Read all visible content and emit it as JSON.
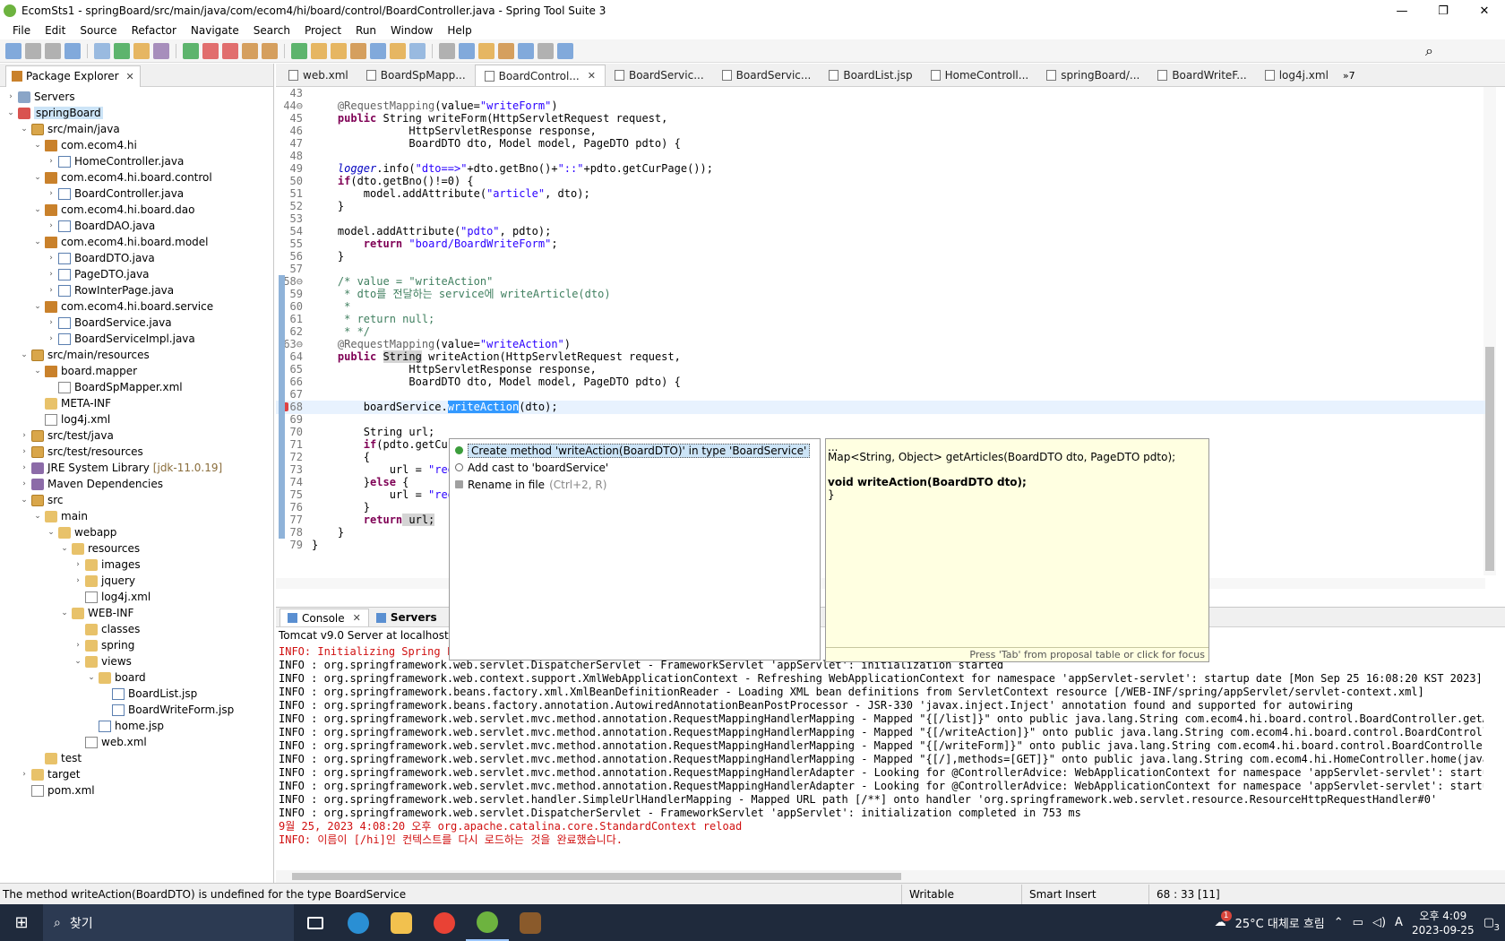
{
  "window": {
    "title": "EcomSts1 - springBoard/src/main/java/com/ecom4/hi/board/control/BoardController.java - Spring Tool Suite 3",
    "minimize": "—",
    "restore": "❐",
    "close": "✕"
  },
  "menu": [
    "File",
    "Edit",
    "Source",
    "Refactor",
    "Navigate",
    "Search",
    "Project",
    "Run",
    "Window",
    "Help"
  ],
  "package_explorer": {
    "tab_label": "Package Explorer",
    "rows": [
      {
        "indent": 0,
        "arrow": "›",
        "icon": "server",
        "label": "Servers"
      },
      {
        "indent": 0,
        "arrow": "⌄",
        "icon": "project",
        "label": "springBoard",
        "selected": true
      },
      {
        "indent": 1,
        "arrow": "⌄",
        "icon": "srcfolder",
        "label": "src/main/java"
      },
      {
        "indent": 2,
        "arrow": "⌄",
        "icon": "pkg",
        "label": "com.ecom4.hi"
      },
      {
        "indent": 3,
        "arrow": "›",
        "icon": "java",
        "label": "HomeController.java"
      },
      {
        "indent": 2,
        "arrow": "⌄",
        "icon": "pkg",
        "label": "com.ecom4.hi.board.control"
      },
      {
        "indent": 3,
        "arrow": "›",
        "icon": "java",
        "label": "BoardController.java"
      },
      {
        "indent": 2,
        "arrow": "⌄",
        "icon": "pkg",
        "label": "com.ecom4.hi.board.dao"
      },
      {
        "indent": 3,
        "arrow": "›",
        "icon": "java",
        "label": "BoardDAO.java"
      },
      {
        "indent": 2,
        "arrow": "⌄",
        "icon": "pkg",
        "label": "com.ecom4.hi.board.model"
      },
      {
        "indent": 3,
        "arrow": "›",
        "icon": "java",
        "label": "BoardDTO.java"
      },
      {
        "indent": 3,
        "arrow": "›",
        "icon": "java",
        "label": "PageDTO.java"
      },
      {
        "indent": 3,
        "arrow": "›",
        "icon": "java",
        "label": "RowInterPage.java"
      },
      {
        "indent": 2,
        "arrow": "⌄",
        "icon": "pkg",
        "label": "com.ecom4.hi.board.service"
      },
      {
        "indent": 3,
        "arrow": "›",
        "icon": "java",
        "label": "BoardService.java"
      },
      {
        "indent": 3,
        "arrow": "›",
        "icon": "java",
        "label": "BoardServiceImpl.java"
      },
      {
        "indent": 1,
        "arrow": "⌄",
        "icon": "srcfolder",
        "label": "src/main/resources"
      },
      {
        "indent": 2,
        "arrow": "⌄",
        "icon": "pkg",
        "label": "board.mapper"
      },
      {
        "indent": 3,
        "arrow": "",
        "icon": "xml",
        "label": "BoardSpMapper.xml"
      },
      {
        "indent": 2,
        "arrow": "",
        "icon": "folder",
        "label": "META-INF"
      },
      {
        "indent": 2,
        "arrow": "",
        "icon": "xml",
        "label": "log4j.xml"
      },
      {
        "indent": 1,
        "arrow": "›",
        "icon": "srcfolder",
        "label": "src/test/java"
      },
      {
        "indent": 1,
        "arrow": "›",
        "icon": "srcfolder",
        "label": "src/test/resources"
      },
      {
        "indent": 1,
        "arrow": "›",
        "icon": "lib",
        "label": "JRE System Library",
        "suffix": "[jdk-11.0.19]"
      },
      {
        "indent": 1,
        "arrow": "›",
        "icon": "lib",
        "label": "Maven Dependencies"
      },
      {
        "indent": 1,
        "arrow": "⌄",
        "icon": "srcfolder",
        "label": "src"
      },
      {
        "indent": 2,
        "arrow": "⌄",
        "icon": "folder",
        "label": "main"
      },
      {
        "indent": 3,
        "arrow": "⌄",
        "icon": "folder",
        "label": "webapp"
      },
      {
        "indent": 4,
        "arrow": "⌄",
        "icon": "folder",
        "label": "resources"
      },
      {
        "indent": 5,
        "arrow": "›",
        "icon": "folder",
        "label": "images"
      },
      {
        "indent": 5,
        "arrow": "›",
        "icon": "folder",
        "label": "jquery"
      },
      {
        "indent": 5,
        "arrow": "",
        "icon": "xml",
        "label": "log4j.xml"
      },
      {
        "indent": 4,
        "arrow": "⌄",
        "icon": "folder",
        "label": "WEB-INF"
      },
      {
        "indent": 5,
        "arrow": "",
        "icon": "folder",
        "label": "classes"
      },
      {
        "indent": 5,
        "arrow": "›",
        "icon": "folder",
        "label": "spring"
      },
      {
        "indent": 5,
        "arrow": "⌄",
        "icon": "folder",
        "label": "views"
      },
      {
        "indent": 6,
        "arrow": "⌄",
        "icon": "folder",
        "label": "board"
      },
      {
        "indent": 7,
        "arrow": "",
        "icon": "java",
        "label": "BoardList.jsp"
      },
      {
        "indent": 7,
        "arrow": "",
        "icon": "java",
        "label": "BoardWriteForm.jsp"
      },
      {
        "indent": 6,
        "arrow": "",
        "icon": "java",
        "label": "home.jsp"
      },
      {
        "indent": 5,
        "arrow": "",
        "icon": "xml",
        "label": "web.xml"
      },
      {
        "indent": 2,
        "arrow": "",
        "icon": "folder",
        "label": "test"
      },
      {
        "indent": 1,
        "arrow": "›",
        "icon": "folder",
        "label": "target"
      },
      {
        "indent": 1,
        "arrow": "",
        "icon": "xml",
        "label": "pom.xml"
      }
    ]
  },
  "editor_tabs": [
    {
      "label": "web.xml"
    },
    {
      "label": "BoardSpMapp..."
    },
    {
      "label": "BoardControl...",
      "active": true
    },
    {
      "label": "BoardServic..."
    },
    {
      "label": "BoardServic..."
    },
    {
      "label": "BoardList.jsp"
    },
    {
      "label": "HomeControll..."
    },
    {
      "label": "springBoard/..."
    },
    {
      "label": "BoardWriteF..."
    },
    {
      "label": "log4j.xml"
    }
  ],
  "editor_tabs_more": "»7",
  "code_lines": [
    {
      "n": "43",
      "s": []
    },
    {
      "n": "44⊖",
      "s": [
        [
          "    ",
          ""
        ],
        [
          "@RequestMapping",
          "ann"
        ],
        [
          "(value=",
          ""
        ],
        [
          "\"writeForm\"",
          "str"
        ],
        [
          ")",
          ""
        ]
      ]
    },
    {
      "n": "45",
      "s": [
        [
          "    ",
          ""
        ],
        [
          "public",
          "kw"
        ],
        [
          " String writeForm(HttpServletRequest request,",
          ""
        ]
      ]
    },
    {
      "n": "46",
      "s": [
        [
          "               HttpServletResponse response,",
          ""
        ]
      ]
    },
    {
      "n": "47",
      "s": [
        [
          "               BoardDTO dto, Model model, PageDTO pdto) {",
          ""
        ]
      ]
    },
    {
      "n": "48",
      "s": []
    },
    {
      "n": "49",
      "s": [
        [
          "    ",
          ""
        ],
        [
          "logger",
          "fld"
        ],
        [
          ".info(",
          ""
        ],
        [
          "\"dto==>\"",
          "str"
        ],
        [
          "+dto.getBno()+",
          ""
        ],
        [
          "\"::\"",
          "str"
        ],
        [
          "+pdto.getCurPage());",
          ""
        ]
      ]
    },
    {
      "n": "50",
      "s": [
        [
          "    ",
          ""
        ],
        [
          "if",
          "kw"
        ],
        [
          "(dto.getBno()!=0) {",
          ""
        ]
      ]
    },
    {
      "n": "51",
      "s": [
        [
          "        model.addAttribute(",
          ""
        ],
        [
          "\"article\"",
          "str"
        ],
        [
          ", dto);",
          ""
        ]
      ]
    },
    {
      "n": "52",
      "s": [
        [
          "    }",
          ""
        ]
      ]
    },
    {
      "n": "53",
      "s": []
    },
    {
      "n": "54",
      "s": [
        [
          "    model.addAttribute(",
          ""
        ],
        [
          "\"pdto\"",
          "str"
        ],
        [
          ", pdto);",
          ""
        ]
      ]
    },
    {
      "n": "55",
      "s": [
        [
          "        ",
          ""
        ],
        [
          "return",
          "kw"
        ],
        [
          " ",
          ""
        ],
        [
          "\"board/BoardWriteForm\"",
          "str"
        ],
        [
          ";",
          ""
        ]
      ]
    },
    {
      "n": "56",
      "s": [
        [
          "    }",
          ""
        ]
      ]
    },
    {
      "n": "57",
      "s": []
    },
    {
      "n": "58⊖",
      "s": [
        [
          "    ",
          ""
        ],
        [
          "/* value = \"writeAction\"",
          "cm"
        ]
      ]
    },
    {
      "n": "59",
      "s": [
        [
          "     ",
          ""
        ],
        [
          "* dto를 전달하는 service에 writeArticle(dto)",
          "cm"
        ]
      ]
    },
    {
      "n": "60",
      "s": [
        [
          "     ",
          ""
        ],
        [
          "*",
          "cm"
        ]
      ]
    },
    {
      "n": "61",
      "s": [
        [
          "     ",
          ""
        ],
        [
          "* return null;",
          "cm"
        ]
      ]
    },
    {
      "n": "62",
      "s": [
        [
          "     ",
          ""
        ],
        [
          "* */",
          "cm"
        ]
      ]
    },
    {
      "n": "63⊖",
      "s": [
        [
          "    ",
          ""
        ],
        [
          "@RequestMapping",
          "ann"
        ],
        [
          "(value=",
          ""
        ],
        [
          "\"writeAction\"",
          "str"
        ],
        [
          ")",
          ""
        ]
      ]
    },
    {
      "n": "64",
      "s": [
        [
          "    ",
          ""
        ],
        [
          "public",
          "kw"
        ],
        [
          " ",
          ""
        ],
        [
          "String",
          "hl"
        ],
        [
          " writeAction(HttpServletRequest request,",
          ""
        ]
      ]
    },
    {
      "n": "65",
      "s": [
        [
          "               HttpServletResponse response,",
          ""
        ]
      ]
    },
    {
      "n": "66",
      "s": [
        [
          "               BoardDTO dto, Model model, PageDTO pdto) {",
          ""
        ]
      ]
    },
    {
      "n": "67",
      "s": []
    },
    {
      "n": "68",
      "s": [
        [
          "        boardService.",
          ""
        ],
        [
          "writeAction",
          "sel"
        ],
        [
          "(dto);",
          ""
        ]
      ],
      "current": true,
      "error": true
    },
    {
      "n": "69",
      "s": []
    },
    {
      "n": "70",
      "s": [
        [
          "        String url;",
          ""
        ]
      ]
    },
    {
      "n": "71",
      "s": [
        [
          "        ",
          ""
        ],
        [
          "if",
          "kw"
        ],
        [
          "(pdto.getCur",
          ""
        ]
      ]
    },
    {
      "n": "72",
      "s": [
        [
          "        {",
          ""
        ]
      ]
    },
    {
      "n": "73",
      "s": [
        [
          "            url = ",
          ""
        ],
        [
          "\"red",
          "str"
        ]
      ]
    },
    {
      "n": "74",
      "s": [
        [
          "        }",
          ""
        ],
        [
          "else",
          "kw"
        ],
        [
          " {",
          ""
        ]
      ]
    },
    {
      "n": "75",
      "s": [
        [
          "            url = ",
          ""
        ],
        [
          "\"red",
          "str"
        ]
      ]
    },
    {
      "n": "76",
      "s": [
        [
          "        }",
          ""
        ]
      ]
    },
    {
      "n": "77",
      "s": [
        [
          "        ",
          ""
        ],
        [
          "return",
          "kw"
        ],
        [
          " url;",
          "hl"
        ]
      ]
    },
    {
      "n": "78",
      "s": [
        [
          "    }",
          ""
        ]
      ]
    },
    {
      "n": "79",
      "s": [
        [
          "}",
          ""
        ]
      ]
    }
  ],
  "quickfix": {
    "items": [
      {
        "icon": "green",
        "label": "Create method 'writeAction(BoardDTO)' in type 'BoardService'",
        "selected": true
      },
      {
        "icon": "cast",
        "label": "Add cast to 'boardService'"
      },
      {
        "icon": "rename",
        "label": "Rename in file",
        "hint": "(Ctrl+2, R)"
      }
    ],
    "info": {
      "line1": "...",
      "line2": "Map<String, Object> getArticles(BoardDTO dto, PageDTO pdto);",
      "line3": "void writeAction(BoardDTO dto);",
      "line4": "}",
      "footer": "Press 'Tab' from proposal table or click for focus"
    }
  },
  "bottom": {
    "tabs": [
      {
        "label": "Console",
        "active": true
      },
      {
        "label": "Servers"
      },
      {
        "label": "P"
      }
    ],
    "console_title": "Tomcat v9.0 Server at localhost [Ap",
    "console_title_tail": "t.",
    "lines": [
      {
        "t": "INFO: Initializing Spring F",
        "red": true
      },
      {
        "t": "INFO : org.springframework.web.servlet.DispatcherServlet - FrameworkServlet 'appServlet': initialization started"
      },
      {
        "t": "INFO : org.springframework.web.context.support.XmlWebApplicationContext - Refreshing WebApplicationContext for namespace 'appServlet-servlet': startup date [Mon Sep 25 16:08:20 KST 2023]; paren"
      },
      {
        "t": "INFO : org.springframework.beans.factory.xml.XmlBeanDefinitionReader - Loading XML bean definitions from ServletContext resource [/WEB-INF/spring/appServlet/servlet-context.xml]"
      },
      {
        "t": "INFO : org.springframework.beans.factory.annotation.AutowiredAnnotationBeanPostProcessor - JSR-330 'javax.inject.Inject' annotation found and supported for autowiring"
      },
      {
        "t": "INFO : org.springframework.web.servlet.mvc.method.annotation.RequestMappingHandlerMapping - Mapped \"{[/list]}\" onto public java.lang.String com.ecom4.hi.board.control.BoardController.getArticle"
      },
      {
        "t": "INFO : org.springframework.web.servlet.mvc.method.annotation.RequestMappingHandlerMapping - Mapped \"{[/writeAction]}\" onto public java.lang.String com.ecom4.hi.board.control.BoardController.wri"
      },
      {
        "t": "INFO : org.springframework.web.servlet.mvc.method.annotation.RequestMappingHandlerMapping - Mapped \"{[/writeForm]}\" onto public java.lang.String com.ecom4.hi.board.control.BoardController.write"
      },
      {
        "t": "INFO : org.springframework.web.servlet.mvc.method.annotation.RequestMappingHandlerMapping - Mapped \"{[/],methods=[GET]}\" onto public java.lang.String com.ecom4.hi.HomeController.home(java.util."
      },
      {
        "t": "INFO : org.springframework.web.servlet.mvc.method.annotation.RequestMappingHandlerAdapter - Looking for @ControllerAdvice: WebApplicationContext for namespace 'appServlet-servlet': startup date"
      },
      {
        "t": "INFO : org.springframework.web.servlet.mvc.method.annotation.RequestMappingHandlerAdapter - Looking for @ControllerAdvice: WebApplicationContext for namespace 'appServlet-servlet': startup date"
      },
      {
        "t": "INFO : org.springframework.web.servlet.handler.SimpleUrlHandlerMapping - Mapped URL path [/**] onto handler 'org.springframework.web.servlet.resource.ResourceHttpRequestHandler#0'"
      },
      {
        "t": "INFO : org.springframework.web.servlet.DispatcherServlet - FrameworkServlet 'appServlet': initialization completed in 753 ms"
      },
      {
        "t": "9월 25, 2023 4:08:20 오후 org.apache.catalina.core.StandardContext reload",
        "red": true
      },
      {
        "t": "INFO: 이름이 [/hi]인 컨텍스트를 다시 로드하는 것을 완료했습니다.",
        "red": true
      }
    ]
  },
  "status": {
    "message": "The method writeAction(BoardDTO) is undefined for the type BoardService",
    "writable": "Writable",
    "insert_mode": "Smart Insert",
    "position": "68 : 33 [11]"
  },
  "taskbar": {
    "search_label": "찾기",
    "weather": "25°C 대체로 흐림",
    "ime": "A",
    "time": "오후 4:09",
    "date": "2023-09-25",
    "notif_count": "3",
    "weather_badge": "1"
  }
}
